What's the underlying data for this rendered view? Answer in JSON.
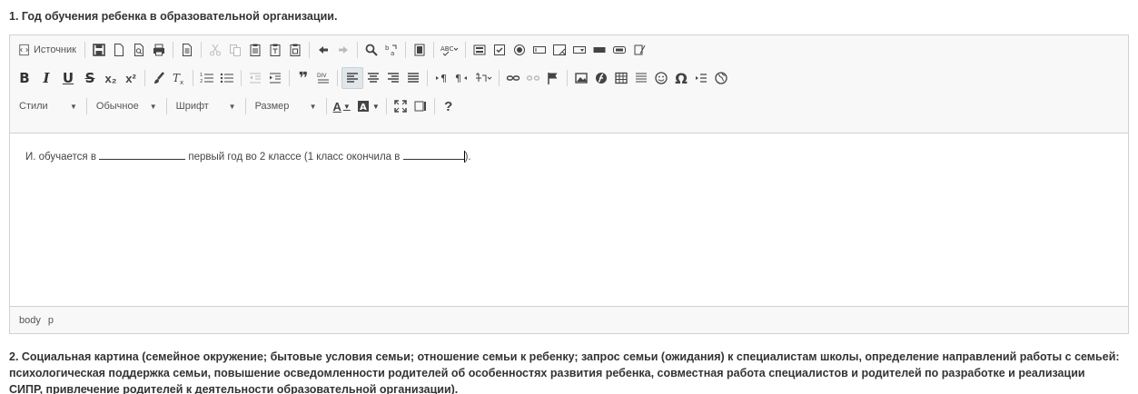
{
  "question1": {
    "title": "1. Год обучения ребенка в образовательной организации."
  },
  "toolbar": {
    "row1": {
      "source_label": "Источник",
      "icons": [
        "source-icon",
        "save-icon",
        "new-page-icon",
        "preview-icon",
        "print-icon",
        "templates-icon",
        "cut-icon",
        "copy-icon",
        "paste-icon",
        "paste-text-icon",
        "paste-word-icon",
        "undo-icon",
        "redo-icon",
        "find-icon",
        "replace-icon",
        "select-all-icon",
        "spellcheck-icon",
        "form-icon",
        "checkbox-icon",
        "radio-icon",
        "textfield-icon",
        "textarea-icon",
        "select-icon",
        "button-icon",
        "image-button-icon",
        "hidden-field-icon"
      ]
    },
    "row2": {
      "bold": "B",
      "italic": "I",
      "underline": "U",
      "strike": "S",
      "subscript": "x₂",
      "superscript": "x²",
      "blockquote": "❞"
    },
    "row3": {
      "styles_label": "Стили",
      "format_label": "Обычное",
      "font_label": "Шрифт",
      "size_label": "Размер",
      "text_color": "A",
      "help": "?"
    }
  },
  "content": {
    "part1": "И. обучается в ",
    "part2": " первый год во 2 классе (1 класс окончила в ",
    "part3": ")."
  },
  "statusbar": {
    "path1": "body",
    "path2": "p"
  },
  "question2": {
    "text": "2. Социальная картина (семейное окружение; бытовые условия семьи; отношение семьи к ребенку; запрос семьи (ожидания) к специалистам школы, определение направлений работы с семьей: психологическая поддержка семьи, повышение осведомленности родителей об особенностях развития ребенка, совместная работа специалистов и родителей по разработке и реализации СИПР, привлечение родителей к деятельности образовательной организации)."
  },
  "colors": {
    "toolbar_bg": "#f8f8f8",
    "border": "#d1d1d1",
    "text": "#333333"
  }
}
